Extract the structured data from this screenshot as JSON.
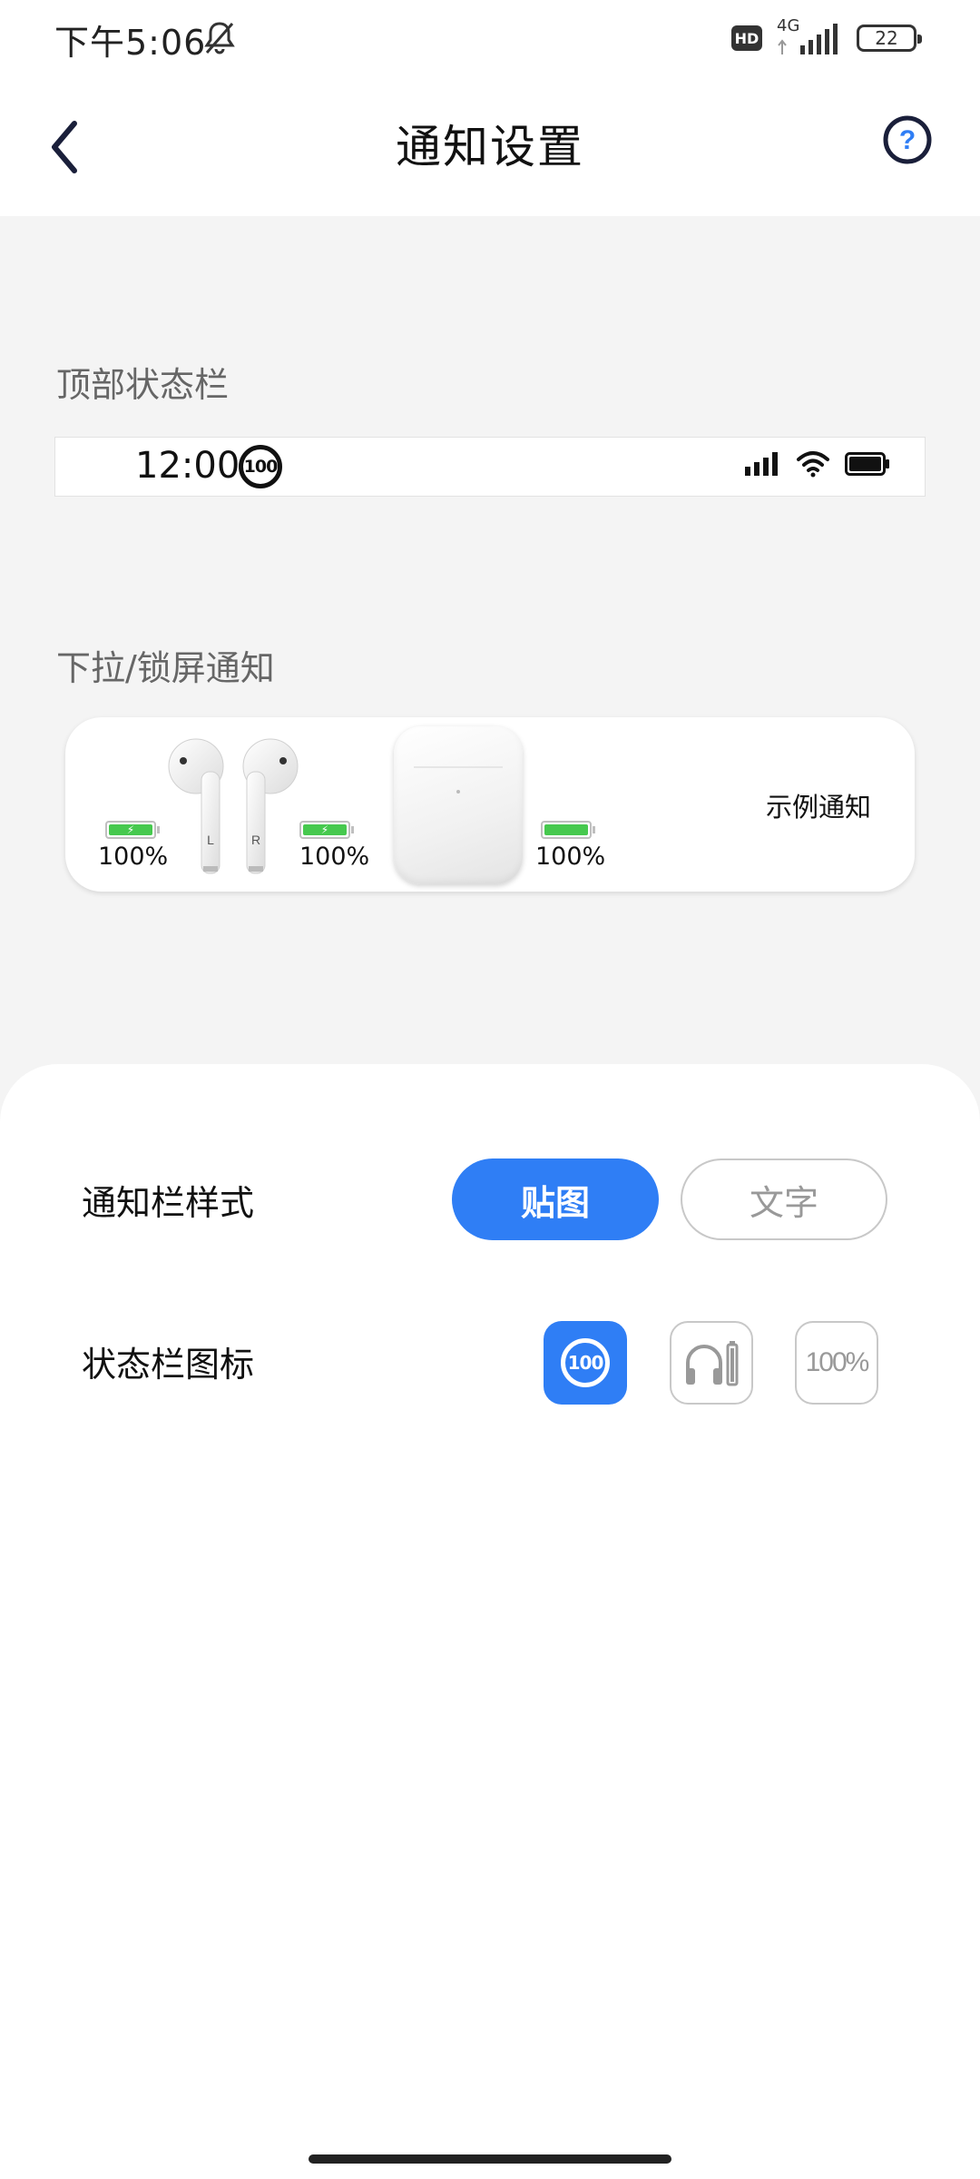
{
  "system_status": {
    "time": "下午5:06",
    "network": "4G",
    "hd_badge": "HD",
    "battery_level": "22"
  },
  "header": {
    "title": "通知设置"
  },
  "sections": {
    "top_statusbar_label": "顶部状态栏",
    "dropdown_label": "下拉/锁屏通知"
  },
  "demo_statusbar": {
    "time": "12:00",
    "badge_text": "100"
  },
  "notification_preview": {
    "left_label": "L",
    "right_label": "R",
    "left_pct": "100%",
    "right_pct": "100%",
    "case_pct": "100%",
    "sample_text": "示例通知"
  },
  "settings": {
    "style_row": {
      "label": "通知栏样式",
      "options": [
        "贴图",
        "文字"
      ],
      "selected": "贴图"
    },
    "icon_row": {
      "label": "状态栏图标",
      "options": [
        "badge-100",
        "headphone-battery",
        "percent-text"
      ],
      "badge_text": "100",
      "percent_text": "100%",
      "selected": "badge-100"
    }
  },
  "colors": {
    "accent": "#2f7ef5",
    "battery_green": "#46c94e",
    "background": "#f4f4f4"
  }
}
